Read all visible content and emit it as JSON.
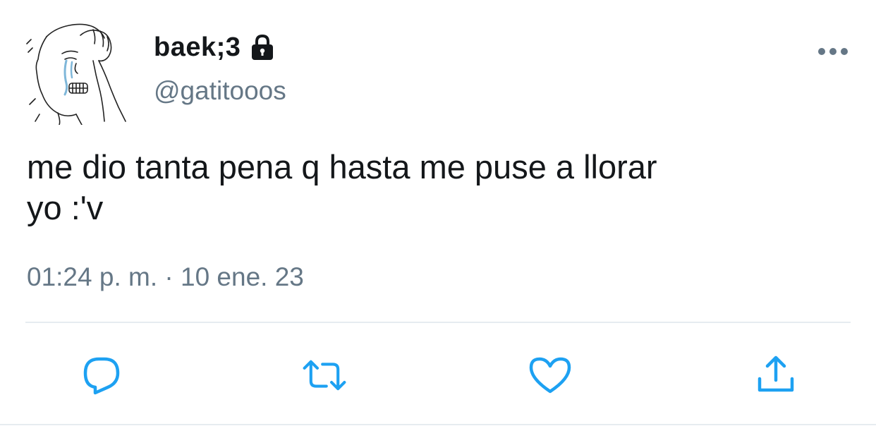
{
  "tweet": {
    "display_name": "baek;3",
    "handle": "@gatitooos",
    "text": "me dio tanta pena q hasta me puse a llorar\nyo :'v",
    "timestamp": "01:24 p. m. · 10 ene. 23",
    "protected": true
  },
  "icons": {
    "avatar": "crying-wojak-avatar",
    "lock": "lock-icon",
    "more": "more-icon",
    "reply": "reply-icon",
    "retweet": "retweet-icon",
    "like": "heart-icon",
    "share": "share-icon"
  },
  "colors": {
    "text_primary": "#14171a",
    "text_secondary": "#657786",
    "icon": "#1da1f2",
    "divider": "#e6ecf0"
  }
}
